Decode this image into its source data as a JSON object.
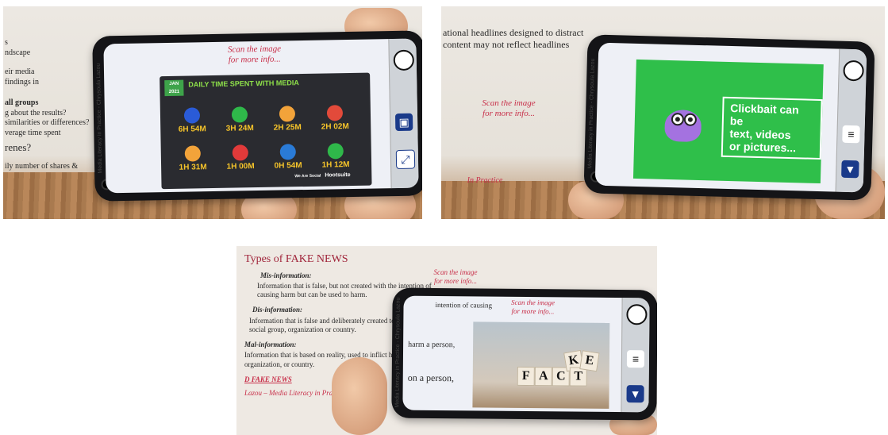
{
  "photo1": {
    "scan_text": "Scan the image\nfor more info...",
    "side_label": "Media Literacy in Practice - Chrysoula Lazou",
    "paper_lines": [
      "s",
      "ndscape",
      "eir media",
      "findings in",
      "all groups",
      "g about the results?",
      "similarities or differences?",
      "verage time spent",
      "renes?",
      "ily number of shares &"
    ],
    "infographic": {
      "badge": "JAN\n2021",
      "title": "DAILY TIME SPENT WITH MEDIA",
      "stats": [
        "6H 54M",
        "3H 24M",
        "2H 25M",
        "2H 02M",
        "1H 31M",
        "1H 00M",
        "0H 54M",
        "1H 12M"
      ],
      "brands": [
        "We Are Social",
        "Hootsuite"
      ]
    }
  },
  "photo2": {
    "paper_lines": [
      "ational headlines designed to distract",
      "content may not reflect headlines"
    ],
    "scan_text": "Scan the image\nfor more info...",
    "footer_text": "In Practice",
    "side_label": "Media Literacy in Practice - Chrysoula Lazou",
    "card_text": "Clickbait can be\ntext, videos\nor pictures..."
  },
  "photo3": {
    "title": "Types of FAKE NEWS",
    "scan_text": "Scan the image\nfor more info...",
    "sections": [
      {
        "heading": "Mis-information:",
        "body": "Information that is false, but not created with the intention of causing harm but can be used to harm."
      },
      {
        "heading": "Dis-information:",
        "body": "Information that is false and deliberately created to harm a person, social group, organization or country."
      },
      {
        "heading": "Mal-information:",
        "body": "Information that is based on reality, used to inflict harm on a person, organization, or country."
      }
    ],
    "link_text": "D FAKE NEWS",
    "footer_text": "Lazou – Media Literacy in Practice",
    "screen_scan_text": "Scan the image\nfor more info...",
    "side_label": "Media Literacy in Practice - Chrysoula Lazou",
    "screen_fragments": [
      "intention of causing",
      "harm a person,",
      "on a person,"
    ],
    "tiles": [
      "F",
      "A",
      "C",
      "K",
      "T",
      "E"
    ]
  }
}
